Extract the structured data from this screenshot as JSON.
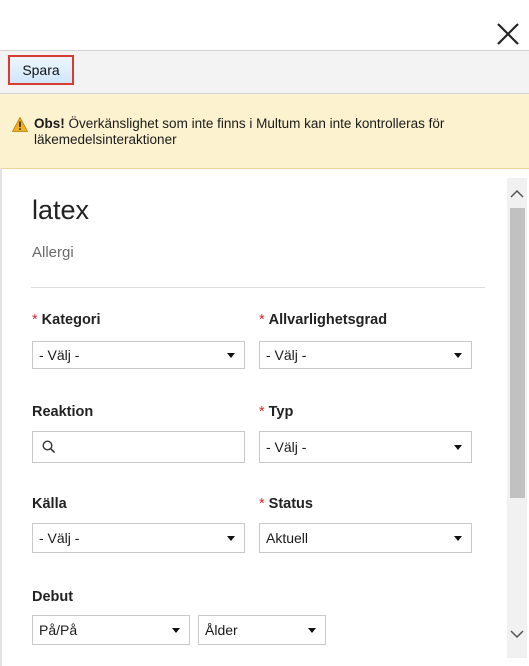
{
  "toolbar": {
    "save_label": "Spara"
  },
  "warning": {
    "bold": "Obs!",
    "text": " Överkänslighet som inte finns i Multum kan inte kontrolleras för läkemedelsinteraktioner"
  },
  "item": {
    "title": "latex",
    "subtitle": "Allergi"
  },
  "form": {
    "kategori": {
      "label": "Kategori",
      "value": "- Välj -",
      "required": true
    },
    "allvarlighetsgrad": {
      "label": "Allvarlighetsgrad",
      "value": "- Välj -",
      "required": true
    },
    "reaktion": {
      "label": "Reaktion",
      "value": ""
    },
    "typ": {
      "label": "Typ",
      "value": "- Välj -",
      "required": true
    },
    "kalla": {
      "label": "Källa",
      "value": "- Välj -"
    },
    "status": {
      "label": "Status",
      "value": "Aktuell",
      "required": true
    },
    "debut": {
      "label": "Debut",
      "precision": "På/På",
      "unit": "Ålder"
    }
  },
  "colors": {
    "required": "#d02a2a",
    "warning_bg": "#fcf2cf",
    "save_border": "#d93b30"
  }
}
